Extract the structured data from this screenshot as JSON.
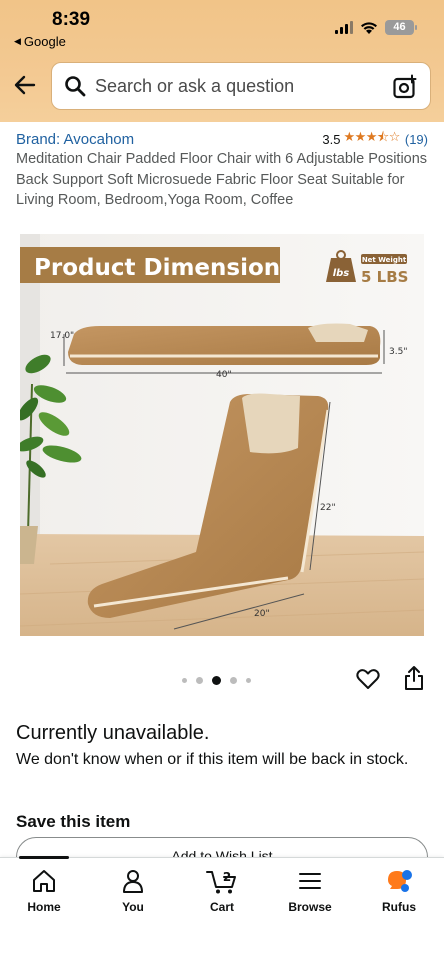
{
  "status_bar": {
    "time": "8:39",
    "back_app": "Google",
    "battery": "46"
  },
  "search": {
    "placeholder": "Search or ask a question"
  },
  "product": {
    "brand": "Brand: Avocahom",
    "rating": "3.5",
    "stars": "★★★⯪☆",
    "rating_count": "(19)",
    "title": "Meditation Chair Padded Floor Chair with 6 Adjustable Positions Back Support Soft Microsuede Fabric Floor Seat Suitable for Living Room, Bedroom,Yoga Room, Coffee",
    "image": {
      "banner": "Product Dimension",
      "weight_label": "Net Weight",
      "weight_value": "5 LBS",
      "weight_icon_text": "lbs",
      "dim_depth": "17.0\"",
      "dim_length": "40\"",
      "dim_thickness": "3.5\"",
      "dim_height": "22\"",
      "dim_width": "20\""
    }
  },
  "carousel": {
    "total": 5,
    "active_index": 2
  },
  "availability": {
    "title": "Currently unavailable.",
    "text": "We don't know when or if this item will be back in stock."
  },
  "save": {
    "title": "Save this item",
    "wishlist_label": "Add to Wish List"
  },
  "nav": {
    "home": "Home",
    "you": "You",
    "cart": "Cart",
    "cart_count": "2",
    "browse": "Browse",
    "rufus": "Rufus"
  },
  "colors": {
    "header_bg": "#f3c992",
    "link_blue": "#2162a1",
    "star_orange": "#de7921",
    "chair_brown": "#b88b55",
    "banner_brown": "#a67c45"
  },
  "icons": {
    "back": "arrow-left-icon",
    "search": "search-icon",
    "lens": "camera-lens-icon",
    "heart": "heart-icon",
    "share": "share-icon",
    "home": "home-icon",
    "you": "person-icon",
    "cart": "cart-icon",
    "browse": "menu-icon",
    "rufus": "rufus-icon"
  }
}
